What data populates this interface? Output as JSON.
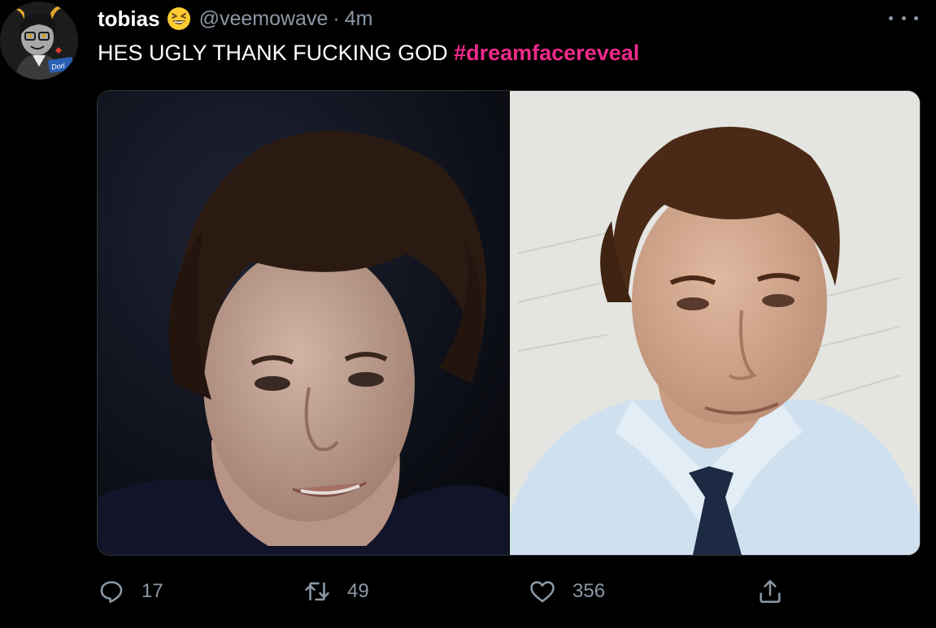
{
  "tweet": {
    "display_name": "tobias",
    "name_emoji": "grinning-squinting-face",
    "handle": "@veemowave",
    "separator": "·",
    "time": "4m",
    "text": "HES UGLY THANK FUCKING GOD ",
    "hashtag": "#dreamfacereveal",
    "avatar_label": "Dori"
  },
  "actions": {
    "reply_count": "17",
    "retweet_count": "49",
    "like_count": "356"
  },
  "icons": [
    "more-icon",
    "reply-icon",
    "retweet-icon",
    "like-icon",
    "share-icon"
  ],
  "colors": {
    "background": "#000000",
    "text": "#ffffff",
    "secondary": "#8b98a5",
    "hashtag": "#f02a8a"
  }
}
